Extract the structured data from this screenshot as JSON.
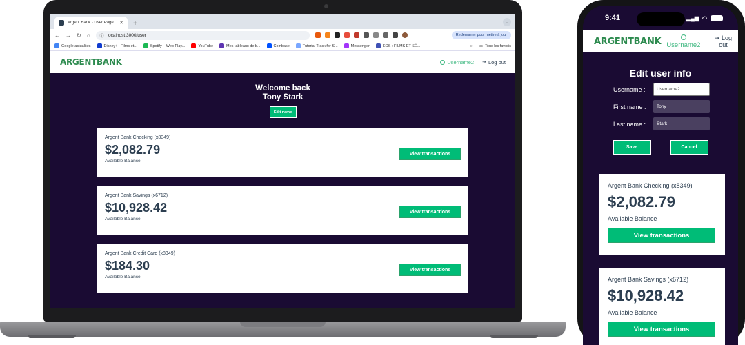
{
  "browser": {
    "tab_title": "Argent Bank - User Page",
    "new_tab": "+",
    "url": "localhost:3000/user",
    "restart_label": "Redémarrer pour mettre à jour",
    "bookmarks": [
      {
        "label": "Google actualités",
        "color": "#4285f4"
      },
      {
        "label": "Disney+ | Films et...",
        "color": "#113ccf"
      },
      {
        "label": "Spotify – Web Play...",
        "color": "#1db954"
      },
      {
        "label": "YouTube",
        "color": "#ff0000"
      },
      {
        "label": "Mes tableaux de b...",
        "color": "#5e35b1"
      },
      {
        "label": "Coinbase",
        "color": "#0052ff"
      },
      {
        "label": "Tutorial Track for S...",
        "color": "#7aa7ff"
      },
      {
        "label": "Messenger",
        "color": "#a334fa"
      },
      {
        "label": "EOS : FILMS ET SÉ...",
        "color": "#3f51b5"
      }
    ],
    "bookmarks_more": "»",
    "all_bookmarks": "Tous les favoris"
  },
  "app": {
    "brand_argent": "ARGENT",
    "brand_bank": "BANK",
    "username": "Username2",
    "logout": "Log out",
    "welcome_line1": "Welcome back",
    "welcome_line2": "Tony Stark",
    "edit_name": "Edit name",
    "accounts": [
      {
        "title": "Argent Bank Checking (x8349)",
        "amount": "$2,082.79",
        "description": "Available Balance",
        "button": "View transactions"
      },
      {
        "title": "Argent Bank Savings (x6712)",
        "amount": "$10,928.42",
        "description": "Available Balance",
        "button": "View transactions"
      },
      {
        "title": "Argent Bank Credit Card (x8349)",
        "amount": "$184.30",
        "description": "Available Balance",
        "button": "View transactions"
      }
    ]
  },
  "mobile": {
    "time": "9:41",
    "edit_title": "Edit user info",
    "username_label": "Username :",
    "username_value": "Username2",
    "firstname_label": "First name :",
    "firstname_value": "Tony",
    "lastname_label": "Last name :",
    "lastname_value": "Stark",
    "save": "Save",
    "cancel": "Cancel",
    "logout_line1": "Log",
    "logout_line2": "out"
  },
  "colors": {
    "brand_green": "#2c8a4e",
    "button_green": "#00bc77",
    "page_background": "#1a0b33",
    "text_dark": "#2c3e50"
  }
}
